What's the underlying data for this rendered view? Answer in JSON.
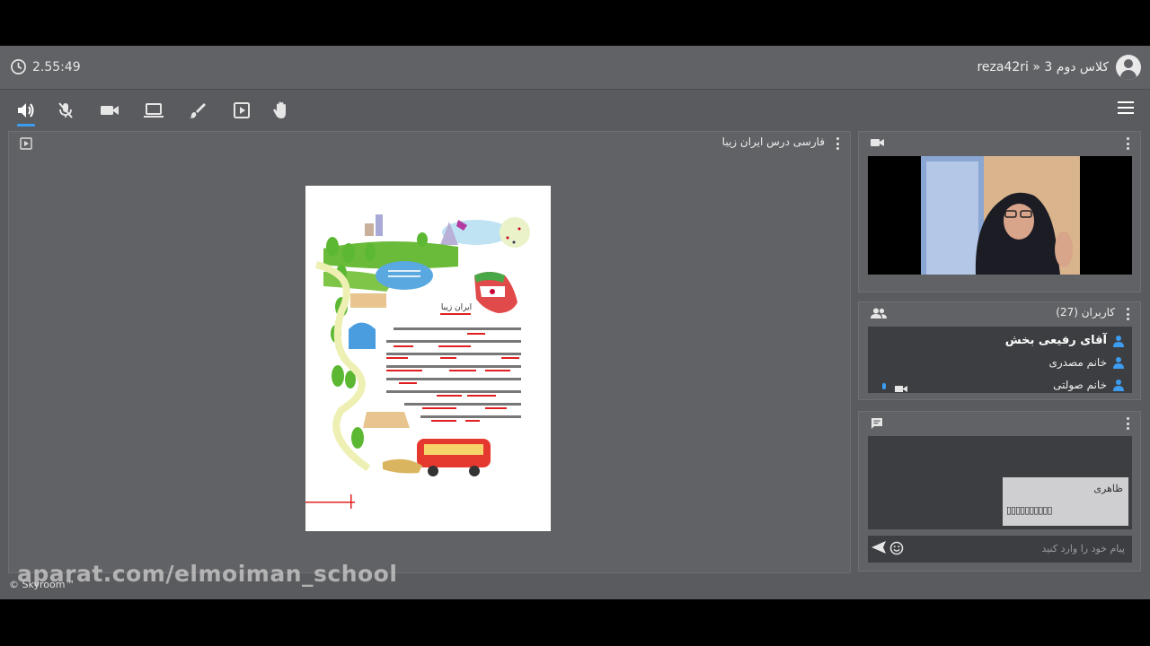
{
  "header": {
    "timer": "2.55:49",
    "breadcrumb": "reza42ri » کلاس دوم 3",
    "clock_icon": "clock-icon",
    "avatar_icon": "account-avatar-icon"
  },
  "toolbar": {
    "buttons": [
      "speaker-icon",
      "mic-off-icon",
      "camera-icon",
      "screen-share-icon",
      "brush-icon",
      "present-icon",
      "raise-hand-icon"
    ],
    "menu_icon": "hamburger-menu-icon"
  },
  "board": {
    "title": "فارسی درس ایران زیبا",
    "page_heading": "ایران زیبا"
  },
  "users_panel": {
    "title": "کاربران (27)",
    "users": [
      "آقای رفیعی بخش",
      "خانم مصدری",
      "خانم صولتی"
    ]
  },
  "chat": {
    "messages": [
      {
        "name": "ظاهری",
        "text": "▯▯▯▯▯▯▯▯▯▯"
      }
    ],
    "placeholder": "پیام خود را وارد کنید"
  },
  "footer": {
    "watermark": "aparat.com/elmoiman_school",
    "copyright": "© Skyroom™"
  },
  "colors": {
    "accent": "#3b9cf0",
    "toolbar_bg": "#616265",
    "panel_dark": "#3d3e41"
  }
}
